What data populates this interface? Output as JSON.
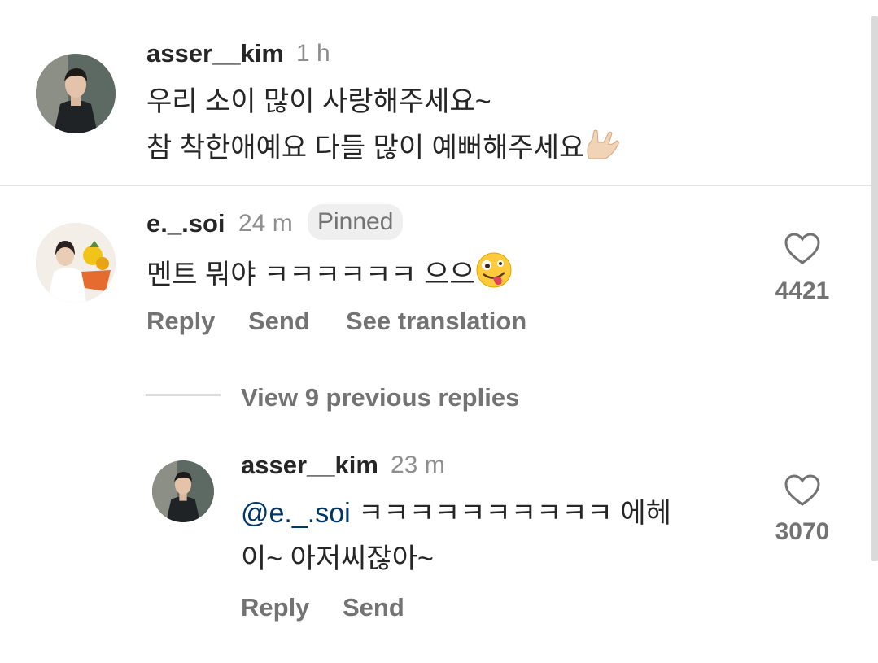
{
  "comments": [
    {
      "username": "asser__kim",
      "time": "1 h",
      "line1": "우리 소이 많이 사랑해주세요~",
      "line2": "참 착한애예요 다들 많이 예뻐해주세요",
      "emoji": "love-you-gesture-emoji"
    },
    {
      "username": "e._.soi",
      "time": "24 m",
      "badge": "Pinned",
      "text": "멘트 뭐야 ㅋㅋㅋㅋㅋㅋ 으으",
      "emoji": "zany-face-emoji",
      "likes": "4421",
      "actions": {
        "reply": "Reply",
        "send": "Send",
        "translate": "See translation"
      }
    }
  ],
  "view_replies": "View 9 previous replies",
  "reply": {
    "username": "asser__kim",
    "time": "23 m",
    "mention": "@e._.soi",
    "text_line1": " ㅋㅋㅋㅋㅋㅋㅋㅋㅋㅋ 에헤",
    "text_line2": "이~ 아저씨잖아~",
    "likes": "3070",
    "actions": {
      "reply": "Reply",
      "send": "Send"
    }
  },
  "icons": {
    "like": "heart-outline-icon"
  },
  "colors": {
    "mention": "#00376b",
    "secondary_text": "#737373",
    "primary_text": "#262626"
  }
}
